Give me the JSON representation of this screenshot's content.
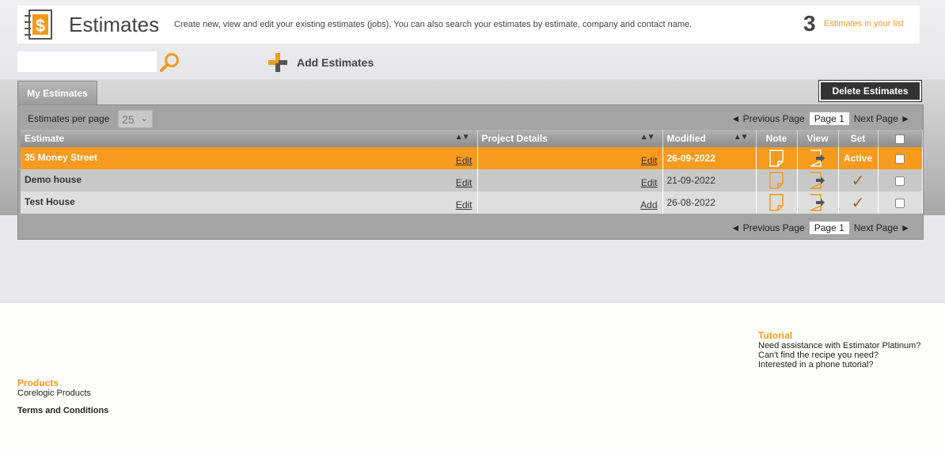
{
  "header": {
    "title": "Estimates",
    "subtitle": "Create new, view and edit your existing estimates (jobs). You can also search your estimates by estimate, company and contact name.",
    "count": "3",
    "count_label": "Estimates in your list"
  },
  "search": {
    "value": "",
    "placeholder": ""
  },
  "toolbar": {
    "add_label": "Add Estimates",
    "delete_label": "Delete Estimates"
  },
  "tabs": [
    {
      "label": "My Estimates"
    }
  ],
  "pager": {
    "per_page_label": "Estimates per page",
    "per_page_value": "25",
    "prev_label": "◄ Previous Page",
    "next_label": "Next Page ►",
    "page_label": "Page 1"
  },
  "table": {
    "columns": [
      "Estimate",
      "Project Details",
      "Modified",
      "Note",
      "View",
      "Set"
    ],
    "sort_glyph": "▲▼",
    "rows": [
      {
        "estimate": "35 Money Street",
        "estimate_action": "Edit",
        "details_action": "Edit",
        "modified": "26-09-2022",
        "set": "Active"
      },
      {
        "estimate": "Demo house",
        "estimate_action": "Edit",
        "details_action": "Edit",
        "modified": "21-09-2022",
        "set": "✓"
      },
      {
        "estimate": "Test House",
        "estimate_action": "Edit",
        "details_action": "Add",
        "modified": "26-08-2022",
        "set": "✓"
      }
    ]
  },
  "footer": {
    "tutorial_title": "Tutorial",
    "tutorial_links": [
      "Need assistance with Estimator Platinum?",
      "Can't find the recipe you need?",
      "Interested in a phone tutorial?"
    ],
    "products_title": "Products",
    "products_link": "Corelogic Products",
    "terms": "Terms and Conditions"
  },
  "colors": {
    "accent": "#f79a1e",
    "dark": "#333333",
    "panel": "#a4a4a4"
  },
  "icons": [
    "dollar-document-icon",
    "search-icon",
    "plus-icon",
    "note-icon",
    "view-icon",
    "checkmark-icon"
  ]
}
